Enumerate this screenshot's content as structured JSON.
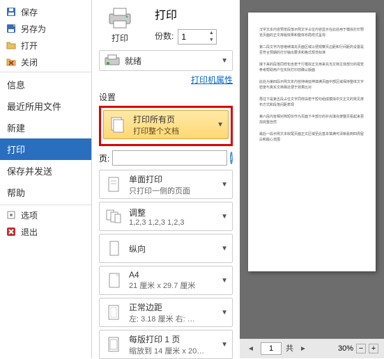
{
  "sidebar": {
    "top_items": [
      {
        "icon": "save-icon",
        "label": "保存"
      },
      {
        "icon": "save-as-icon",
        "label": "另存为"
      },
      {
        "icon": "open-icon",
        "label": "打开"
      },
      {
        "icon": "close-icon",
        "label": "关闭"
      }
    ],
    "groups": [
      "信息",
      "最近所用文件",
      "新建"
    ],
    "active": "打印",
    "after": [
      "保存并发送",
      "帮助"
    ],
    "bottom_items": [
      {
        "icon": "options-icon",
        "label": "选项"
      },
      {
        "icon": "exit-icon",
        "label": "退出"
      }
    ]
  },
  "middle": {
    "print_title": "打印",
    "print_button": "打印",
    "copies_label": "份数:",
    "copies_value": "1",
    "printer_status": "就绪",
    "printer_props": "打印机属性",
    "settings_label": "设置",
    "highlighted": {
      "title": "打印所有页",
      "sub": "打印整个文档"
    },
    "pages_label": "页:",
    "pages_value": "",
    "options": [
      {
        "title": "单面打印",
        "sub": "只打印一侧的页面"
      },
      {
        "title": "调整",
        "sub": "1,2,3   1,2,3   1,2,3"
      },
      {
        "title": "纵向",
        "sub": ""
      },
      {
        "title": "A4",
        "sub": "21 厘米 x 29.7 厘米"
      },
      {
        "title": "正常边距",
        "sub": "左: 3.18 厘米 右: …"
      },
      {
        "title": "每版打印 1 页",
        "sub": "缩放到 14 厘米 x 20…"
      }
    ]
  },
  "preview": {
    "page_current": "1",
    "page_total_label": "共",
    "zoom": "30%"
  }
}
